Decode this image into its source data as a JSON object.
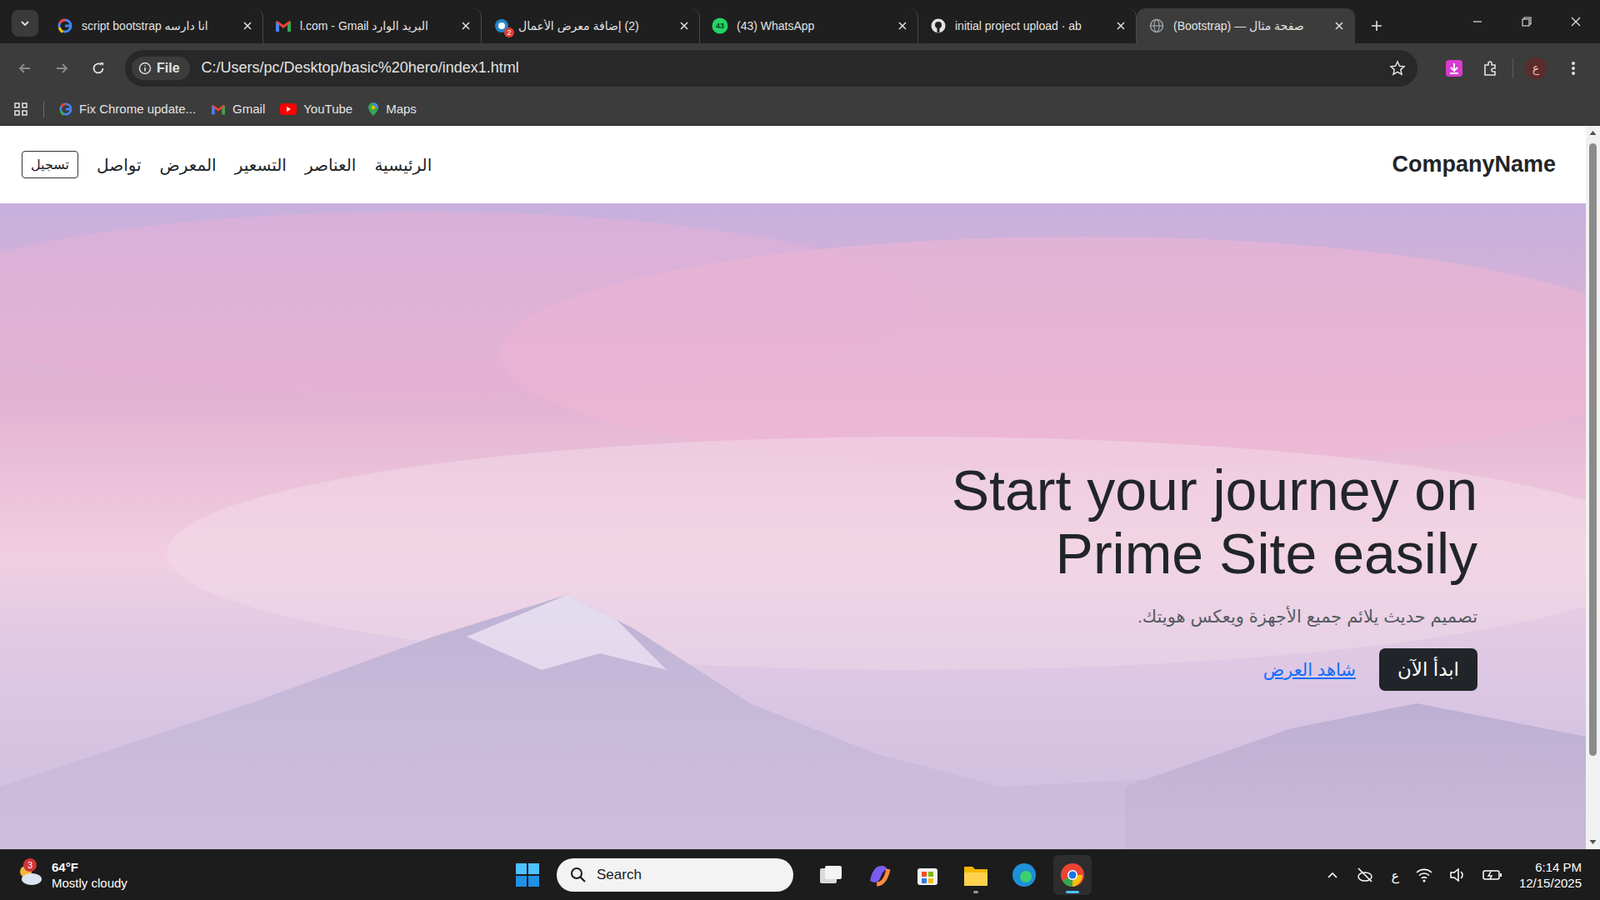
{
  "browser": {
    "tabs": [
      {
        "title": "انا دارسه script bootstrap",
        "selected": false
      },
      {
        "title": "البريد الوارد l.com - Gmail",
        "selected": false
      },
      {
        "title": "(2) إضافة معرض الأعمال",
        "selected": false,
        "badge": "2"
      },
      {
        "title": "(43) WhatsApp",
        "selected": false,
        "badge": "43"
      },
      {
        "title": "initial project upload · ab",
        "selected": false
      },
      {
        "title": "صفحة مثال — (Bootstrap)",
        "selected": true
      }
    ],
    "address": {
      "scheme": "File",
      "url": "C:/Users/pc/Desktop/basic%20hero/index1.html",
      "bookmarked": false
    },
    "bookmarks": [
      "Fix Chrome update...",
      "Gmail",
      "YouTube",
      "Maps"
    ],
    "profile": "ع"
  },
  "page": {
    "nav": {
      "brand": "CompanyName",
      "links": [
        "الرئيسية",
        "العناصر",
        "التسعير",
        "المعرض",
        "تواصل"
      ],
      "button": "تسجيل"
    },
    "hero": {
      "title": "Start your journey on Prime Site easily",
      "subtitle": "تصميم حديث يلائم جميع الأجهزة ويعكس هويتك.",
      "primary": "ابدأ الآن",
      "secondary": "شاهد العرض"
    },
    "scrollbar": {
      "level": 0.89
    }
  },
  "taskbar": {
    "weather": {
      "badge": "3",
      "temp": "64°F",
      "condition": "Mostly cloudy"
    },
    "search": {
      "placeholder": "Search"
    },
    "apps": [
      {
        "running": false,
        "selected": false
      },
      {
        "running": false,
        "selected": false
      },
      {
        "running": false,
        "selected": false
      },
      {
        "running": true,
        "selected": false
      },
      {
        "running": false,
        "selected": false
      },
      {
        "running": true,
        "selected": true
      }
    ],
    "tray": {
      "language": "ع",
      "time": "6:14 PM",
      "date": "12/15/2025"
    }
  }
}
